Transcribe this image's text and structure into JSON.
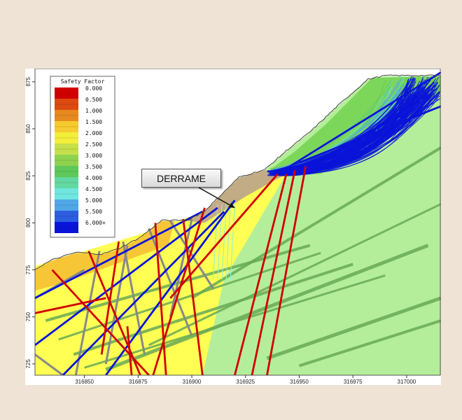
{
  "chart_data": {
    "type": "contour",
    "title": "",
    "xlabel": "",
    "ylabel": "",
    "x_ticks": [
      316850,
      316875,
      316900,
      316925,
      316950,
      316975,
      317000
    ],
    "y_ticks": [
      725,
      750,
      775,
      800,
      825,
      850,
      875
    ],
    "xlim": [
      316827,
      317016
    ],
    "ylim": [
      719,
      882
    ],
    "legend": {
      "title": "Safety Factor",
      "placement": "top-left",
      "entries": [
        {
          "label": "0.000",
          "color": "#d10000"
        },
        {
          "label": "0.500",
          "color": "#dc4a10"
        },
        {
          "label": "1.000",
          "color": "#e8891f"
        },
        {
          "label": "1.500",
          "color": "#f5cb2f"
        },
        {
          "label": "2.000",
          "color": "#f2ee3a"
        },
        {
          "label": "2.500",
          "color": "#c5e04a"
        },
        {
          "label": "3.000",
          "color": "#8fd24e"
        },
        {
          "label": "3.500",
          "color": "#5ec85a"
        },
        {
          "label": "4.000",
          "color": "#62d9a0"
        },
        {
          "label": "4.500",
          "color": "#6fe6e0"
        },
        {
          "label": "5.000",
          "color": "#4fa7e6"
        },
        {
          "label": "5.500",
          "color": "#2d5ee0"
        },
        {
          "label": "6.000+",
          "color": "#0a14d8"
        }
      ]
    },
    "annotation": {
      "text": "DERRAME",
      "target": [
        316920,
        808
      ]
    },
    "surface_profile": [
      [
        316827,
        775
      ],
      [
        316835,
        780
      ],
      [
        316846,
        784
      ],
      [
        316858,
        783
      ],
      [
        316866,
        786
      ],
      [
        316876,
        792
      ],
      [
        316886,
        801
      ],
      [
        316898,
        801
      ],
      [
        316906,
        806
      ],
      [
        316914,
        815
      ],
      [
        316922,
        824
      ],
      [
        316934,
        828
      ],
      [
        316944,
        838
      ],
      [
        316955,
        848
      ],
      [
        316968,
        862
      ],
      [
        316982,
        876
      ],
      [
        316990,
        878
      ],
      [
        317016,
        878
      ]
    ],
    "colors": {
      "background_zone": "#b5ee9b",
      "weak_layer": "#ffff54",
      "upper_layer": "#f7c637",
      "debris": "#c2ac85",
      "bands": "#67a955",
      "faults": "#888888",
      "high_fs": "#0a14d8",
      "low_fs": "#d10000"
    }
  }
}
